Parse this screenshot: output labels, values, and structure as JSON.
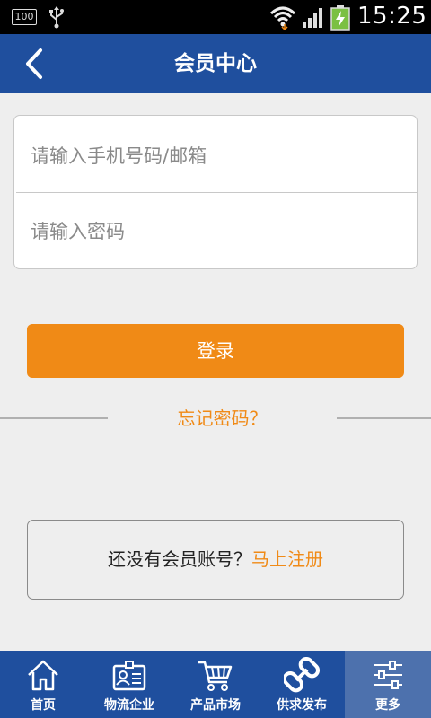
{
  "status_bar": {
    "battery_small": "100",
    "time": "15:25"
  },
  "header": {
    "title": "会员中心"
  },
  "login_form": {
    "phone_placeholder": "请输入手机号码/邮箱",
    "password_placeholder": "请输入密码",
    "login_label": "登录",
    "forgot_label": "忘记密码？"
  },
  "register": {
    "prompt": "还没有会员账号？",
    "link": "马上注册"
  },
  "bottom_nav": {
    "items": [
      {
        "label": "首页",
        "icon": "home-icon"
      },
      {
        "label": "物流企业",
        "icon": "id-card-icon"
      },
      {
        "label": "产品市场",
        "icon": "cart-icon"
      },
      {
        "label": "供求发布",
        "icon": "link-icon"
      },
      {
        "label": "更多",
        "icon": "sliders-icon"
      }
    ],
    "active_index": 4
  },
  "colors": {
    "primary": "#1f4f9e",
    "accent": "#f08a16",
    "active_nav": "#4d71ad"
  }
}
